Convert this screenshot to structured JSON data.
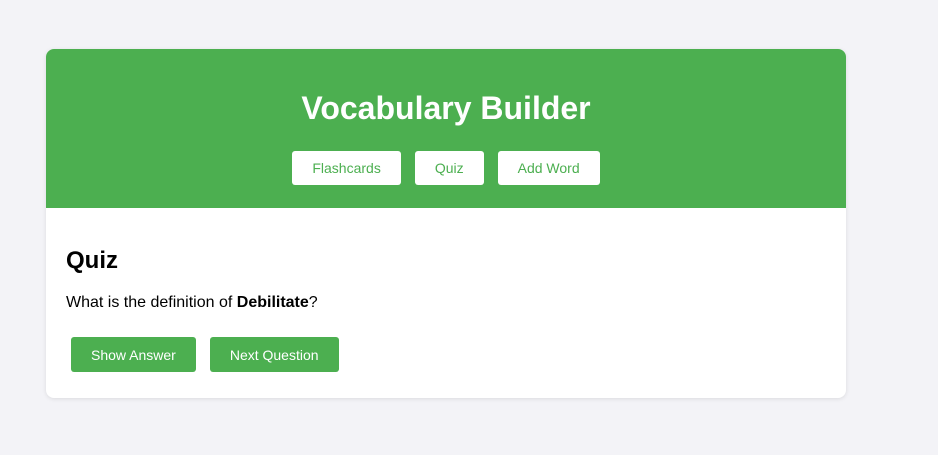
{
  "header": {
    "title": "Vocabulary Builder",
    "nav": [
      {
        "label": "Flashcards"
      },
      {
        "label": "Quiz"
      },
      {
        "label": "Add Word"
      }
    ]
  },
  "quiz": {
    "heading": "Quiz",
    "question_prefix": "What is the definition of ",
    "word": "Debilitate",
    "question_suffix": "?",
    "show_answer_label": "Show Answer",
    "next_question_label": "Next Question"
  },
  "colors": {
    "accent": "#4caf50",
    "page_background": "#f3f3f7",
    "card_background": "#ffffff"
  }
}
